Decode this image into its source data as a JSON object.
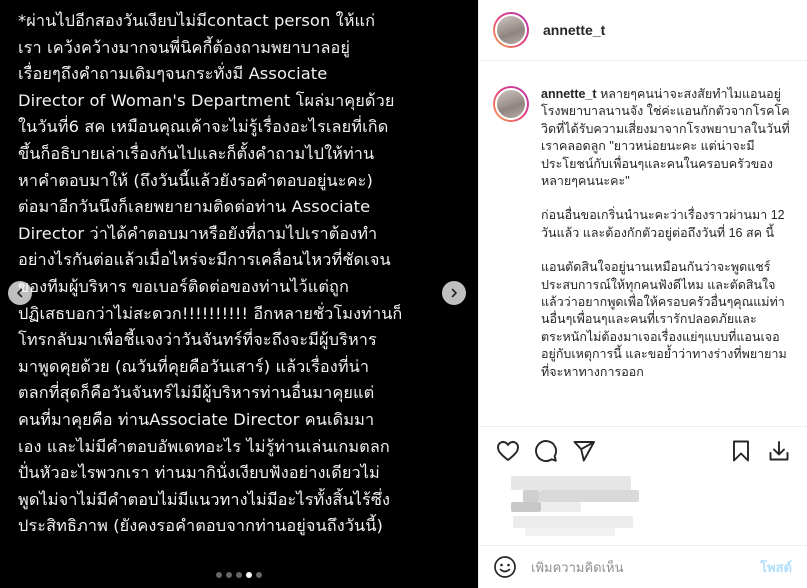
{
  "media": {
    "lines": [
      "*ผ่านไปอีกสองวันเงียบไม่มีcontact person ให้แก่",
      "เรา เคว้งคว้างมากจนพี่นิคกี้ต้องถามพยาบาลอยู่",
      "เรื่อยๆถึงคำถามเดิมๆจนกระทั่งมี Associate",
      "Director of Woman's Department โผล่มาคุยด้วย",
      "ในวันที่6 สค เหมือนคุณเค้าจะไม่รู้เรื่องอะไรเลยที่เกิด",
      "ขึ้นก็อธิบายเล่าเรื่องกันไปและก็ตั้งคำถามไปให้ท่าน",
      "หาคำตอบมาให้ (ถึงวันนี้แล้วยังรอคำตอบอยู่นะคะ)",
      "ต่อมาอีกวันนึงก็เลยพยายามติดต่อท่าน Associate",
      "Director ว่าได้คำตอบมาหรือยังที่ถามไปเราต้องทำ",
      "อย่างไรกันต่อแล้วเมื่อไหร่จะมีการเคลื่อนไหวที่ชัดเจน",
      "ของทีมผู้บริหาร ขอเบอร์ติดต่อของท่านไว้แต่ถูก",
      "ปฏิเสธบอกว่าไม่สะดวก!!!!!!!!!! อีกหลายชั่วโมงท่านก็",
      "โทรกลับมาเพื่อชี้แจงว่าวันจันทร์ที่จะถึงจะมีผู้บริหาร",
      "มาพูดคุยด้วย (ณวันที่คุยคือวันเสาร์) แล้วเรื่องที่น่า",
      "ตลกที่สุดก็คือวันจันทร์ไม่มีผู้บริหารท่านอื่นมาคุยแต่",
      "คนที่มาคุยคือ ท่านAssociate Director คนเดิมมา",
      "เอง และไม่มีคำตอบอัพเดทอะไร ไม่รู้ท่านเล่นเกมตลก",
      "ปั่นหัวอะไรพวกเรา ท่านมากินั่งเงียบฟังอย่างเดียวไม่",
      "พูดไม่จาไม่มีคำตอบไม่มีแนวทางไม่มีอะไรทั้งสิ้นไร้ซึ่ง",
      "ประสิทธิภาพ (ยังคงรอคำตอบจากท่านอยู่จนถึงวันนี้)"
    ]
  },
  "header": {
    "username": "annette_t"
  },
  "caption": {
    "username": "annette_t",
    "p1": "หลายๆคนน่าจะสงสัยทำไมแอนอยู่โรงพยาบาลนานจัง ใช่ค่ะแอนกักตัวจากโรคโควิดที่ได้รับความเสี่ยงมาจากโรงพยาบาลในวันที่เราคลอดลูก \"ยาวหน่อยนะคะ แต่น่าจะมีประโยชน์กับเพื่อนๆและคนในครอบครัวของหลายๆคนนะคะ\"",
    "p2": "ก่อนอื่นขอเกริ่นนำนะคะว่าเรื่องราวผ่านมา 12 วันแล้ว และต้องกักตัวอยู่ต่อถึงวันที่ 16 สค นี้",
    "p3": "แอนตัดสินใจอยู่นานเหมือนกันว่าจะพูดแชร์ประสบการณ์ให้ทุกคนฟังดีไหม และตัดสินใจแล้วว่าอยากพูดเพื่อให้ครอบครัวอื่นๆคุณแม่ท่านอื่นๆเพื่อนๆและคนที่เรารักปลอดภัยและตระหนักไม่ต้องมาเจอเรื่องแย่ๆแบบที่แอนเจออยู่กับเหตุการนี้ และขอย้ำว่าทางร่างที่พยายามที่จะหาทางการออก"
  },
  "actions": {
    "like_icon": "heart-icon",
    "comment_icon": "comment-icon",
    "share_icon": "share-icon",
    "save_icon": "bookmark-icon",
    "download_icon": "download-icon"
  },
  "comment_box": {
    "placeholder": "เพิ่มความคิดเห็น",
    "post_label": "โพสต์"
  },
  "colors": {
    "link_disabled": "#b2dffc",
    "text": "#262626",
    "muted": "#8e8e8e",
    "story_ring_start": "#f9a94c",
    "story_ring_end": "#b534b1"
  }
}
